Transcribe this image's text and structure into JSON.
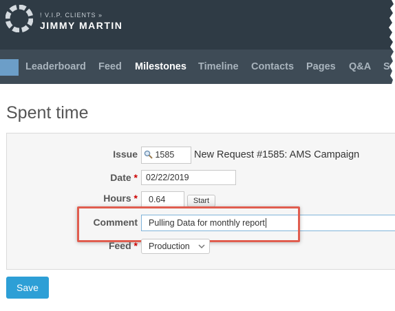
{
  "header": {
    "superscript": "! V.I.P. CLIENTS »",
    "project": "JIMMY MARTIN"
  },
  "nav": {
    "items": [
      {
        "label": "Leaderboard",
        "active": false
      },
      {
        "label": "Feed",
        "active": false
      },
      {
        "label": "Milestones",
        "active": true
      },
      {
        "label": "Timeline",
        "active": false
      },
      {
        "label": "Contacts",
        "active": false
      },
      {
        "label": "Pages",
        "active": false
      },
      {
        "label": "Q&A",
        "active": false
      },
      {
        "label": "S",
        "active": false
      }
    ]
  },
  "page": {
    "title": "Spent time"
  },
  "form": {
    "issue": {
      "label": "Issue",
      "value": "1585",
      "text": "New Request #1585: AMS Campaign"
    },
    "date": {
      "label": "Date",
      "required": "*",
      "value": "02/22/2019"
    },
    "hours": {
      "label": "Hours",
      "required": "*",
      "value": "0.64",
      "start_label": "Start"
    },
    "comment": {
      "label": "Comment",
      "value": "Pulling Data for monthly report"
    },
    "feed": {
      "label": "Feed",
      "required": "*",
      "selected": "Production"
    }
  },
  "actions": {
    "save_label": "Save"
  },
  "colors": {
    "brand_bar": "#2f3b45",
    "nav_bar": "#3e4b56",
    "accent": "#2d9fd6",
    "highlight": "#e05d4f"
  }
}
